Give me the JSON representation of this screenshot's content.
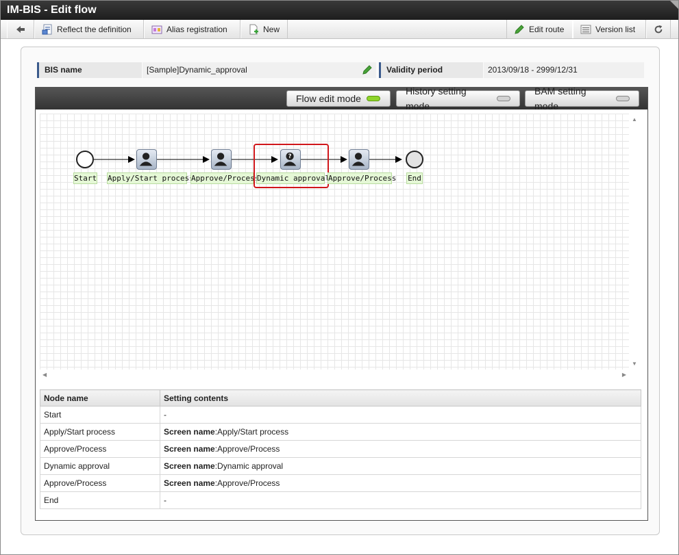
{
  "window": {
    "title": "IM-BIS - Edit flow"
  },
  "toolbar": {
    "reflect_label": "Reflect the definition",
    "alias_label": "Alias registration",
    "new_label": "New",
    "edit_route_label": "Edit route",
    "version_list_label": "Version list"
  },
  "info": {
    "bis_name_label": "BIS name",
    "bis_name_value": "[Sample]Dynamic_approval",
    "validity_label": "Validity period",
    "validity_value": "2013/09/18 - 2999/12/31"
  },
  "modes": {
    "flow_edit": "Flow edit mode",
    "history_setting": "History setting mode",
    "bam_setting": "BAM setting mode",
    "active": "flow_edit"
  },
  "flow": {
    "nodes": [
      {
        "label": "Start",
        "type": "start"
      },
      {
        "label": "Apply/Start process",
        "type": "user"
      },
      {
        "label": "Approve/Process",
        "type": "user"
      },
      {
        "label": "Dynamic approval",
        "type": "dynamic",
        "highlighted": true
      },
      {
        "label": "Approve/Process",
        "type": "user"
      },
      {
        "label": "End",
        "type": "end"
      }
    ]
  },
  "table": {
    "headers": [
      "Node name",
      "Setting contents"
    ],
    "rows": [
      {
        "node": "Start",
        "prefix": "",
        "value": "-"
      },
      {
        "node": "Apply/Start process",
        "prefix": "Screen name",
        "value": ":Apply/Start process"
      },
      {
        "node": "Approve/Process",
        "prefix": "Screen name",
        "value": ":Approve/Process"
      },
      {
        "node": "Dynamic approval",
        "prefix": "Screen name",
        "value": ":Dynamic approval"
      },
      {
        "node": "Approve/Process",
        "prefix": "Screen name",
        "value": ":Approve/Process"
      },
      {
        "node": "End",
        "prefix": "",
        "value": "-"
      }
    ]
  },
  "colors": {
    "highlight": "#d0161a",
    "label_bg": "#e5f8d6",
    "active_led": "#8fd42b"
  }
}
